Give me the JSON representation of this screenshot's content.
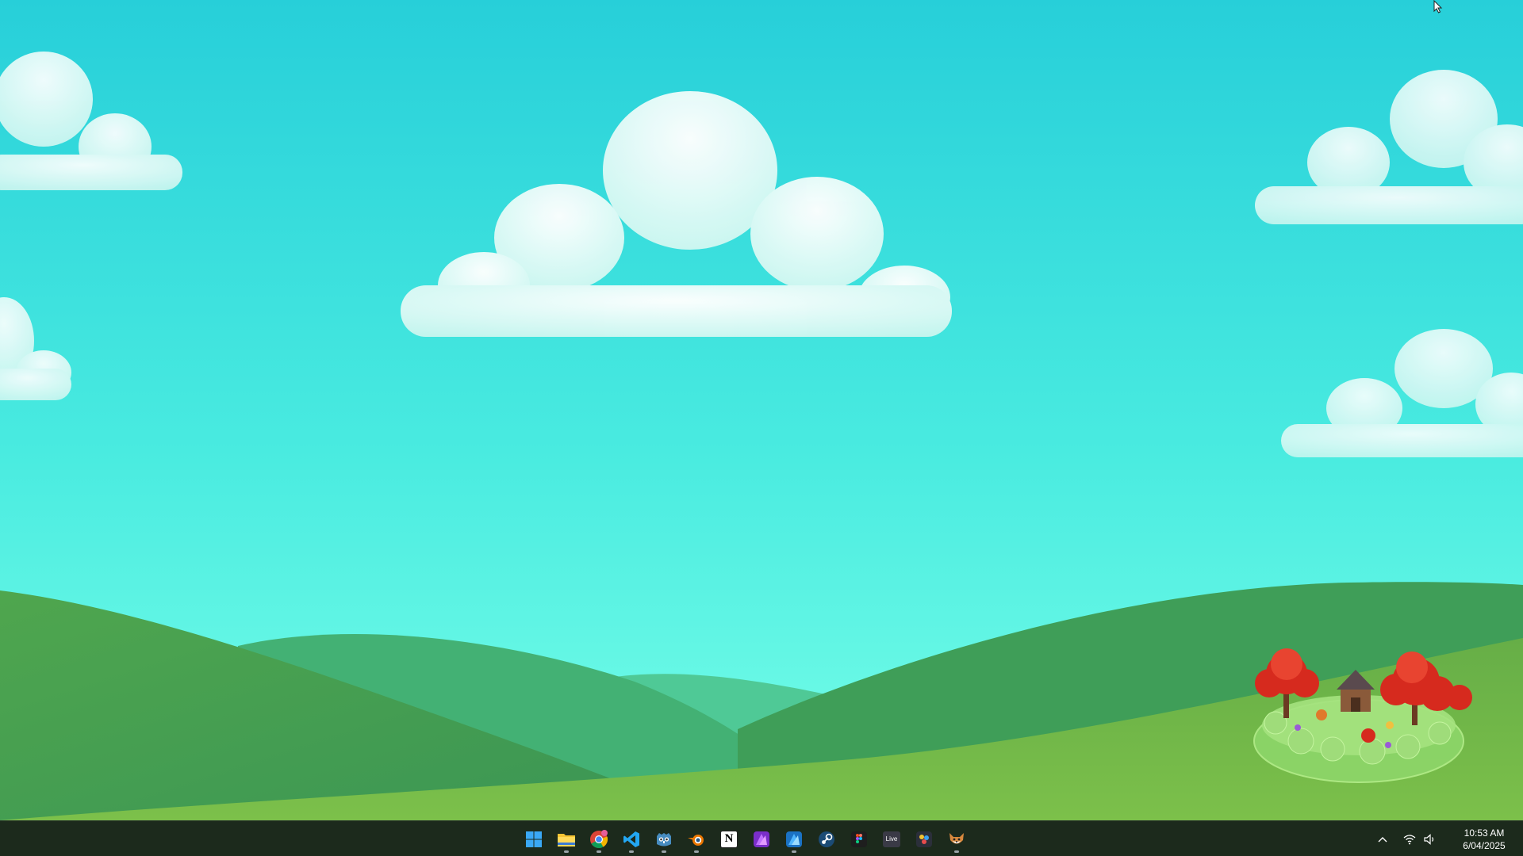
{
  "desktop": {
    "wallpaper": "cartoon sky with clouds and green rolling hills",
    "colors": {
      "sky_top": "#27cfd9",
      "sky_bottom": "#72ffe9",
      "hill_dark": "#3f9e58",
      "hill_light": "#6fb648",
      "tree_red": "#d62a1e"
    }
  },
  "taskbar": {
    "background": "#1c2a1c",
    "apps": [
      {
        "name": "start-icon",
        "running": false
      },
      {
        "name": "file-explorer-icon",
        "running": true
      },
      {
        "name": "chrome-icon",
        "running": true
      },
      {
        "name": "vscode-icon",
        "running": true
      },
      {
        "name": "godot-icon",
        "running": true
      },
      {
        "name": "blender-icon",
        "running": true
      },
      {
        "name": "notion-icon",
        "running": false,
        "glyph": "N"
      },
      {
        "name": "affinity-photo-icon",
        "running": false
      },
      {
        "name": "affinity-designer-icon",
        "running": true
      },
      {
        "name": "steam-icon",
        "running": false
      },
      {
        "name": "figma-icon",
        "running": false
      },
      {
        "name": "live-icon",
        "running": false,
        "glyph": "Live"
      },
      {
        "name": "davinci-resolve-icon",
        "running": false
      },
      {
        "name": "pet-app-icon",
        "running": true
      }
    ],
    "tray": {
      "icons": [
        "chevron-up-icon",
        "wifi-icon",
        "volume-icon"
      ],
      "time": "10:53 AM",
      "date": "6/04/2025"
    }
  }
}
